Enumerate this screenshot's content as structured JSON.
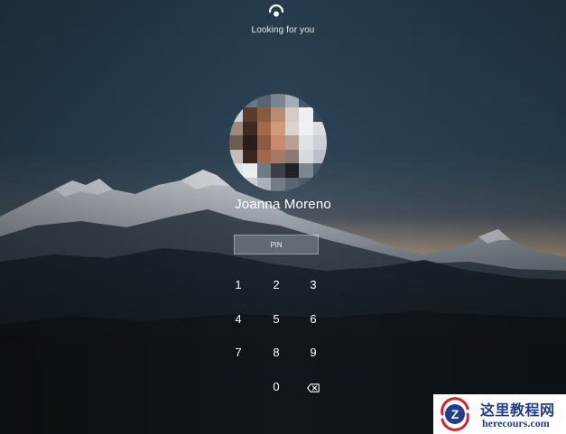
{
  "face_recognition": {
    "icon": "face-scan-icon",
    "status": "Looking for you"
  },
  "user": {
    "avatar": "user-avatar-pixelated",
    "name": "Joanna Moreno"
  },
  "pin": {
    "placeholder": "PIN"
  },
  "keypad": {
    "keys": [
      "1",
      "2",
      "3",
      "4",
      "5",
      "6",
      "7",
      "8",
      "9",
      "0"
    ],
    "backspace_icon": "backspace-icon"
  },
  "watermark": {
    "title": "这里教程网",
    "url": "herecours.com",
    "logo_letter": "Z"
  },
  "colors": {
    "sky_top": "#2a4356",
    "sky_horizon": "#c79c72",
    "mountains": "#141d24",
    "accent_text": "#ffffff",
    "watermark_text": "#1f3d8a",
    "watermark_red": "#d4242a"
  }
}
